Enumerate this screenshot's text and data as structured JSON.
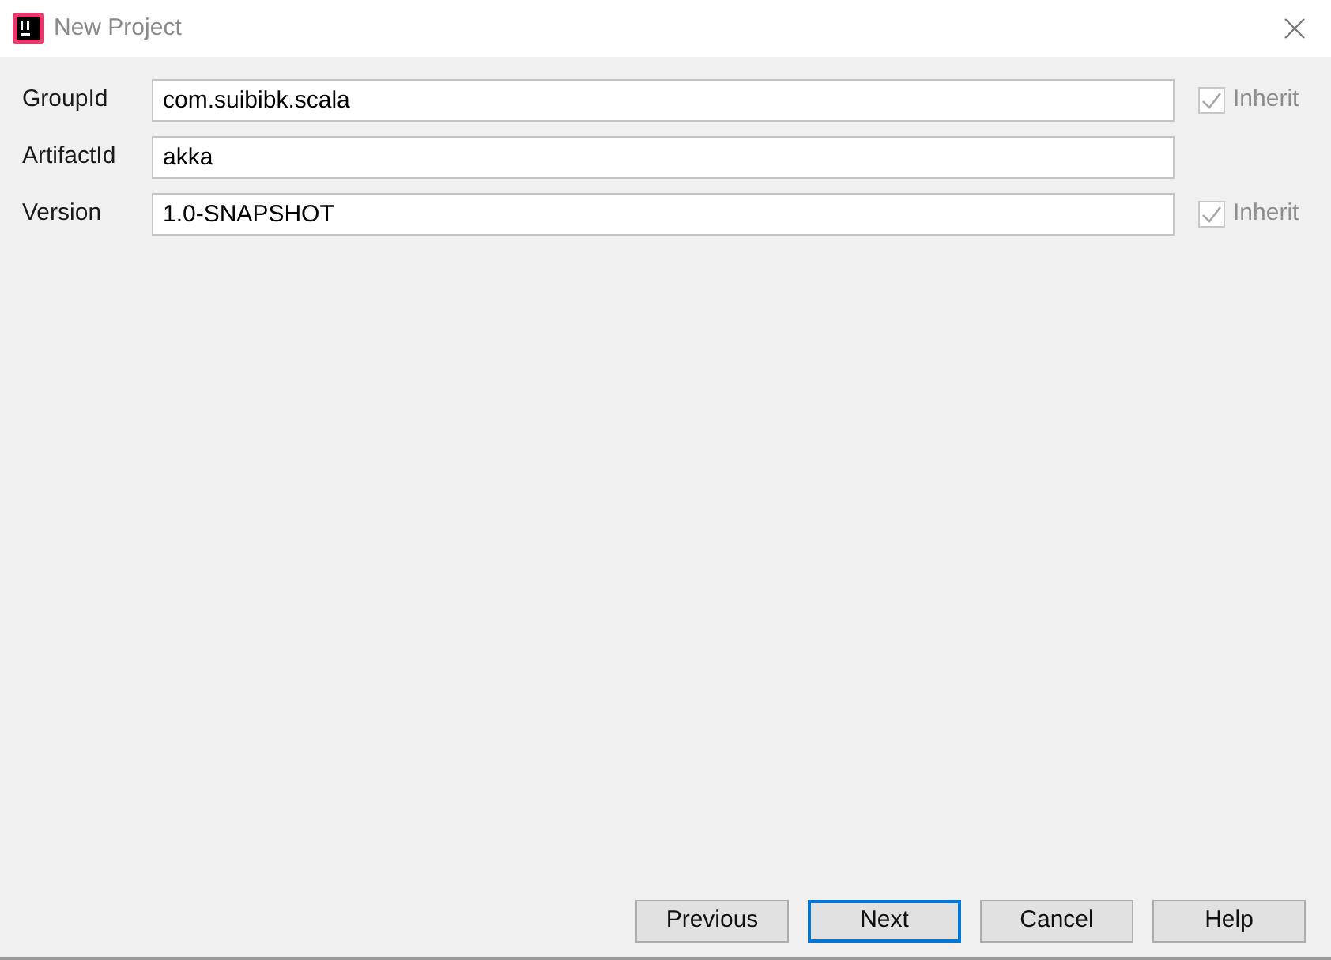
{
  "window": {
    "title": "New Project"
  },
  "fields": [
    {
      "label": "GroupId",
      "value": "com.suibibk.scala",
      "inherit": {
        "label": "Inherit",
        "checked": true,
        "disabled": true
      }
    },
    {
      "label": "ArtifactId",
      "value": "akka"
    },
    {
      "label": "Version",
      "value": "1.0-SNAPSHOT",
      "inherit": {
        "label": "Inherit",
        "checked": true,
        "disabled": true
      }
    }
  ],
  "buttons": [
    {
      "label": "Previous",
      "default": false
    },
    {
      "label": "Next",
      "default": true
    },
    {
      "label": "Cancel",
      "default": false
    },
    {
      "label": "Help",
      "default": false
    }
  ]
}
